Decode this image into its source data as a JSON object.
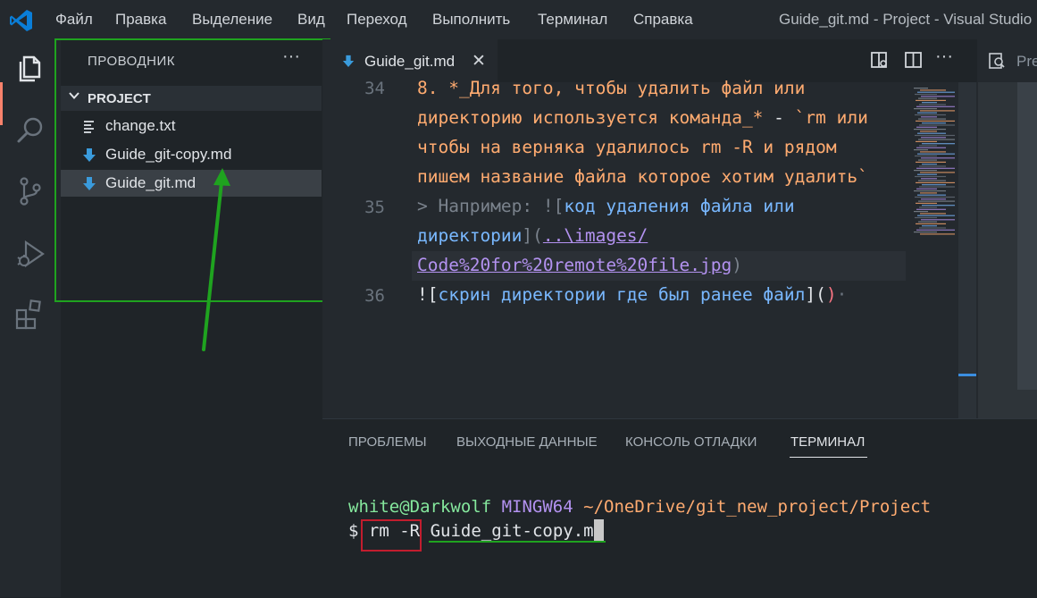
{
  "titlebar": {
    "menu": [
      "Файл",
      "Правка",
      "Выделение",
      "Вид",
      "Переход",
      "Выполнить",
      "Терминал",
      "Справка"
    ],
    "window_title": "Guide_git.md - Project - Visual Studio"
  },
  "activitybar": {
    "icons": [
      "files-icon",
      "search-icon",
      "source-control-icon",
      "run-debug-icon",
      "extensions-icon"
    ]
  },
  "sidebar": {
    "title": "ПРОВОДНИК",
    "more": "···",
    "project": "PROJECT",
    "files": [
      {
        "name": "change.txt",
        "icon": "text-file-icon"
      },
      {
        "name": "Guide_git-copy.md",
        "icon": "markdown-file-icon"
      },
      {
        "name": "Guide_git.md",
        "icon": "markdown-file-icon",
        "selected": true
      }
    ]
  },
  "editor": {
    "tab": {
      "label": "Guide_git.md",
      "close": "✕"
    },
    "toolbar_more": "···",
    "second_tab": "Pre",
    "line_numbers": [
      "34",
      "35",
      "36"
    ],
    "lines": [
      {
        "segments": [
          {
            "t": "8. *_Для того, чтобы удалить файл или",
            "c": "#ffab70"
          }
        ]
      },
      {
        "segments": [
          {
            "t": "директорию используется команда_* ",
            "c": "#ffab70"
          },
          {
            "t": "- ",
            "c": "#e1e4e8"
          },
          {
            "t": "`rm или",
            "c": "#ffab70"
          }
        ]
      },
      {
        "segments": [
          {
            "t": "чтобы на верняка удалилось rm -R и рядом",
            "c": "#ffab70"
          }
        ]
      },
      {
        "segments": [
          {
            "t": "пишем название файла которое хотим удалить`",
            "c": "#ffab70"
          }
        ]
      },
      {
        "segments": [
          {
            "t": "> Например: ![",
            "c": "#7a828c"
          },
          {
            "t": "код удаления файла или",
            "c": "#79b8ff"
          }
        ]
      },
      {
        "segments": [
          {
            "t": "директории",
            "c": "#79b8ff"
          },
          {
            "t": "](",
            "c": "#7a828c"
          },
          {
            "t": "..\\images/",
            "c": "#b392f0",
            "u": true
          }
        ]
      },
      {
        "segments": [
          {
            "t": "Code%20for%20remote%20file.jpg",
            "c": "#b392f0",
            "u": true
          },
          {
            "t": ")",
            "c": "#7a828c"
          }
        ]
      },
      {
        "segments": [
          {
            "t": "![",
            "c": "#e1e4e8"
          },
          {
            "t": "скрин директории где был ранее файл",
            "c": "#79b8ff"
          },
          {
            "t": "](",
            "c": "#e1e4e8"
          },
          {
            "t": ")",
            "c": "#f97583"
          },
          {
            "t": "·",
            "c": "#6a737d"
          }
        ]
      }
    ]
  },
  "panel": {
    "tabs": [
      "ПРОБЛЕМЫ",
      "ВЫХОДНЫЕ ДАННЫЕ",
      "КОНСОЛЬ ОТЛАДКИ",
      "ТЕРМИНАЛ"
    ],
    "active_tab": "ТЕРМИНАЛ",
    "terminal": {
      "user": "white@Darkwolf",
      "env": "MINGW64",
      "path": "~/OneDrive/git_new_project/Project",
      "prompt": "$",
      "command": "rm -R",
      "argument": "Guide_git-copy.md"
    }
  },
  "colors": {
    "highlight_box": "#1fa31f",
    "command_box": "#c21d2e",
    "accent": "#f9826c"
  }
}
